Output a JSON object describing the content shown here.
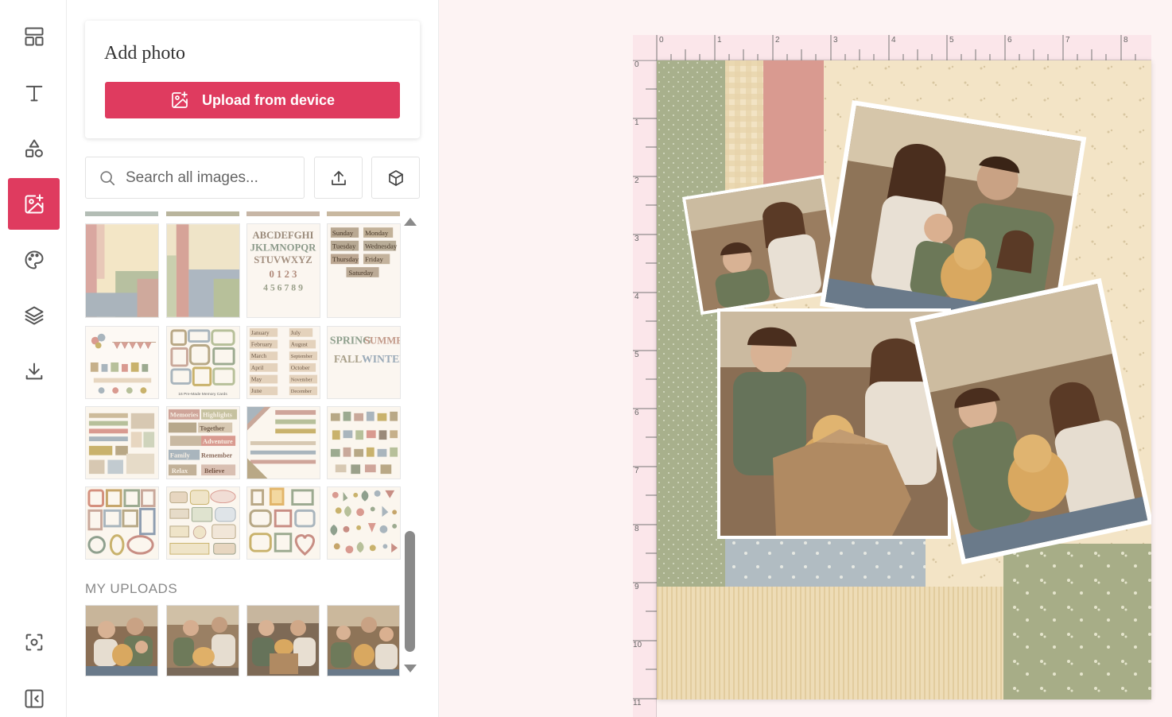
{
  "rail": {
    "items": [
      {
        "name": "layouts",
        "icon": "layout-icon"
      },
      {
        "name": "text",
        "icon": "text-icon"
      },
      {
        "name": "shapes",
        "icon": "shapes-icon"
      },
      {
        "name": "images",
        "icon": "add-image-icon",
        "active": true
      },
      {
        "name": "colors",
        "icon": "palette-icon"
      },
      {
        "name": "layers",
        "icon": "layers-icon"
      },
      {
        "name": "download",
        "icon": "download-icon"
      },
      {
        "name": "screenshot",
        "icon": "focus-icon"
      },
      {
        "name": "collapse-panel",
        "icon": "panel-collapse-icon"
      }
    ]
  },
  "panel": {
    "add_photo_title": "Add photo",
    "upload_button": "Upload from device",
    "search_placeholder": "Search all images...",
    "my_uploads_label": "MY UPLOADS"
  },
  "thumbnails": {
    "alphabet_lines": [
      "ABCDEFGHI",
      "JKLMNOPQR",
      "STUVWXYZ",
      "0 1 2 3",
      "4 5 6 7 8 9"
    ],
    "weekdays": [
      "Sunday",
      "Monday",
      "Tuesday",
      "Wednesday",
      "Thursday",
      "Friday",
      "Saturday"
    ],
    "months": [
      "January",
      "July",
      "February",
      "August",
      "March",
      "September",
      "April",
      "October",
      "May",
      "November",
      "June",
      "December"
    ],
    "seasons": [
      "SPRING",
      "SUMMER",
      "FALL",
      "WINTER"
    ],
    "memory_cards_caption": "16 Pre-Made Memory Cards",
    "word_tags": [
      "Memories",
      "Highlights",
      "Together",
      "Adventure",
      "Family",
      "Remember",
      "Relax",
      "Believe"
    ]
  },
  "ruler": {
    "top": [
      "0",
      "1",
      "2",
      "3",
      "4",
      "5",
      "6",
      "7",
      "8"
    ],
    "left": [
      "0",
      "1",
      "2",
      "3",
      "4",
      "5",
      "6",
      "7",
      "8",
      "9",
      "10",
      "11"
    ]
  },
  "colors": {
    "accent": "#df3b5f",
    "sage": "#a8b08c",
    "cream": "#f2e3c4",
    "pink": "#d99a90",
    "dusty_blue": "#a9b5bd"
  }
}
